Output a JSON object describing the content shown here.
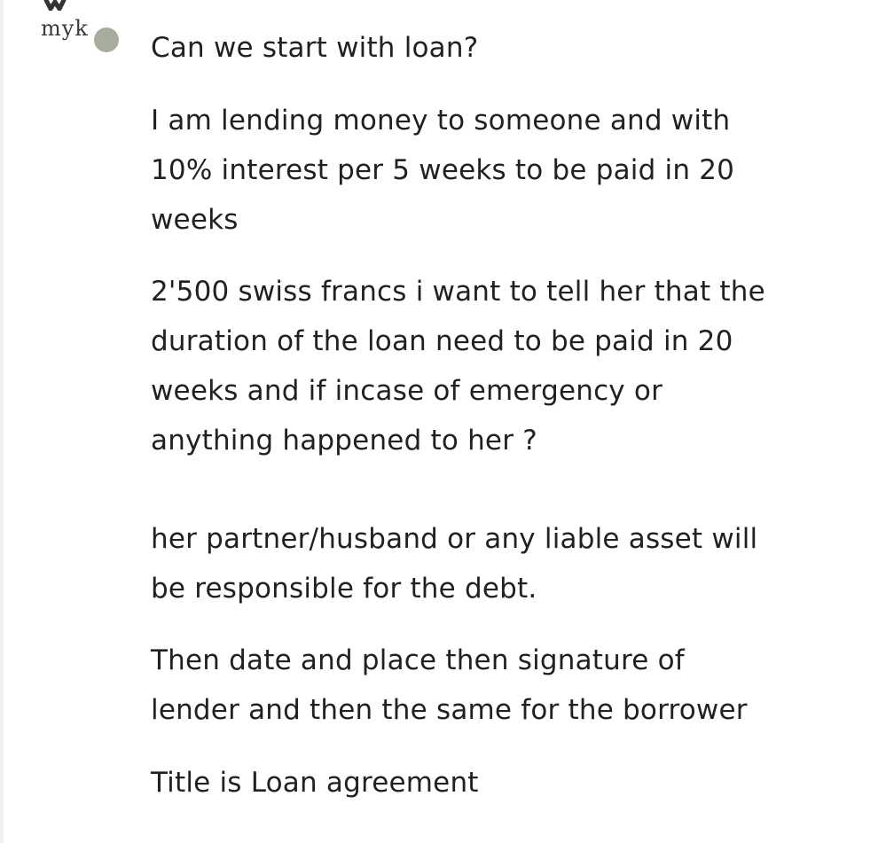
{
  "avatar": {
    "logo_text": "myk",
    "logo_icon": "brand-logo-icon",
    "status_color": "#a6ad9f"
  },
  "message": {
    "paragraphs": [
      "Can we start with loan?",
      "I am lending money to someone and with\n10% interest per 5 weeks to be paid in 20\nweeks",
      "2'500 swiss francs i want to tell her that the\nduration of the loan need to be paid in 20\nweeks and if incase of emergency or\nanything happened to her ?",
      "her partner/husband or any liable asset will\nbe responsible for the debt.",
      "Then date and place then signature of\nlender and then the same for the borrower",
      "Title is Loan agreement"
    ]
  }
}
